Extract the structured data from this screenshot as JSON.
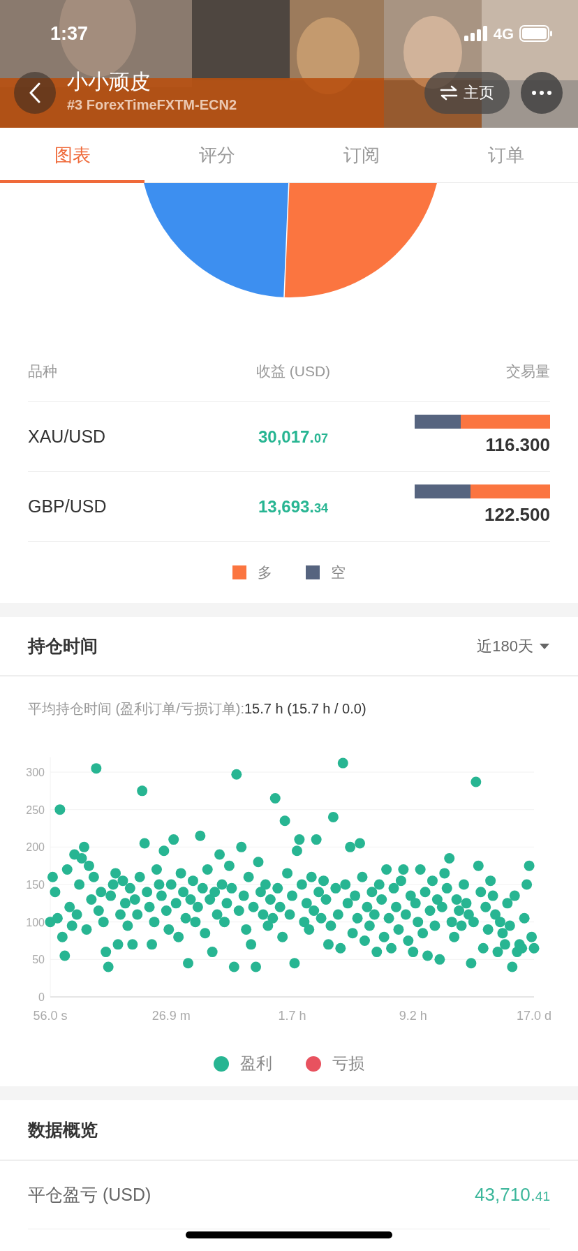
{
  "status_bar": {
    "time": "1:37",
    "network": "4G"
  },
  "header": {
    "title": "小小顽皮",
    "subtitle": "#3 ForexTimeFXTM-ECN2",
    "home_button": "主页"
  },
  "tabs": [
    {
      "label": "图表",
      "selected": true
    },
    {
      "label": "评分",
      "selected": false
    },
    {
      "label": "订阅",
      "selected": false
    },
    {
      "label": "订单",
      "selected": false
    }
  ],
  "symbols_table": {
    "columns": [
      "品种",
      "收益 (USD)",
      "交易量"
    ],
    "rows": [
      {
        "symbol": "XAU/USD",
        "profit_main": "30,017.",
        "profit_decimals": "07",
        "volume": "116.300",
        "long_part": {
          "level": 0.66
        }
      },
      {
        "symbol": "GBP/USD",
        "profit_main": "13,693.",
        "profit_decimals": "34",
        "volume": "122.500",
        "long_part": {
          "level": 0.59
        }
      }
    ],
    "legend": [
      {
        "label": "多",
        "color": "#fb7540"
      },
      {
        "label": "空",
        "color": "#56647f"
      }
    ]
  },
  "holding_time": {
    "title": "持仓时间",
    "period": "近180天",
    "summary_label": "平均持仓时间 (盈利订单/亏损订单):",
    "summary_value": "15.7 h (15.7 h / 0.0)",
    "chart_data": {
      "type": "scatter",
      "grid": true,
      "ylim": [
        0,
        320
      ],
      "yticks": [
        0,
        50,
        100,
        150,
        200,
        250,
        300
      ],
      "categories": [
        "56.0 s",
        null,
        null,
        null,
        null,
        null,
        null,
        null,
        null,
        null,
        null,
        null,
        null,
        null,
        null,
        null,
        null,
        null,
        null,
        null,
        null,
        null,
        null,
        null,
        null,
        null,
        null,
        null,
        null,
        null,
        null,
        null,
        null,
        null,
        null,
        null,
        null,
        null,
        null,
        null,
        null,
        null,
        null,
        null,
        null,
        null,
        null,
        null,
        null,
        null,
        "26.9 m",
        null,
        null,
        null,
        null,
        null,
        null,
        null,
        null,
        null,
        null,
        null,
        null,
        null,
        null,
        null,
        null,
        null,
        null,
        null,
        null,
        null,
        null,
        null,
        null,
        null,
        null,
        null,
        null,
        null,
        null,
        null,
        null,
        null,
        null,
        null,
        null,
        null,
        null,
        null,
        null,
        null,
        null,
        null,
        null,
        null,
        null,
        null,
        null,
        null,
        "1.7 h",
        null,
        null,
        null,
        null,
        null,
        null,
        null,
        null,
        null,
        null,
        null,
        null,
        null,
        null,
        null,
        null,
        null,
        null,
        null,
        null,
        null,
        null,
        null,
        null,
        null,
        null,
        null,
        null,
        null,
        null,
        null,
        null,
        null,
        null,
        null,
        null,
        null,
        null,
        null,
        null,
        null,
        null,
        null,
        null,
        null,
        null,
        null,
        null,
        null,
        "9.2 h",
        null,
        null,
        null,
        null,
        null,
        null,
        null,
        null,
        null,
        null,
        null,
        null,
        null,
        null,
        null,
        null,
        null,
        null,
        null,
        null,
        null,
        null,
        null,
        null,
        null,
        null,
        null,
        null,
        null,
        null,
        null,
        null,
        null,
        null,
        null,
        null,
        null,
        null,
        null,
        null,
        null,
        null,
        null,
        null,
        null,
        null,
        null,
        null,
        null,
        "17.0 d"
      ],
      "series": [
        {
          "name": "盈利",
          "color": "#27b592",
          "values": [
            100,
            160,
            140,
            105,
            250,
            80,
            55,
            170,
            120,
            95,
            190,
            110,
            150,
            185,
            200,
            90,
            175,
            130,
            160,
            305,
            115,
            140,
            100,
            60,
            40,
            135,
            150,
            165,
            70,
            110,
            155,
            125,
            95,
            145,
            70,
            130,
            110,
            160,
            275,
            205,
            140,
            120,
            70,
            100,
            170,
            150,
            135,
            195,
            115,
            90,
            150,
            210,
            125,
            80,
            165,
            140,
            105,
            45,
            130,
            155,
            100,
            120,
            215,
            145,
            85,
            170,
            130,
            60,
            140,
            110,
            190,
            150,
            100,
            125,
            175,
            145,
            40,
            297,
            115,
            200,
            135,
            90,
            160,
            70,
            120,
            40,
            180,
            140,
            110,
            150,
            95,
            130,
            105,
            265,
            145,
            120,
            80,
            235,
            165,
            110,
            135,
            45,
            195,
            210,
            150,
            100,
            125,
            90,
            160,
            115,
            210,
            140,
            105,
            155,
            130,
            70,
            95,
            240,
            145,
            110,
            65,
            312,
            150,
            125,
            200,
            85,
            135,
            105,
            205,
            160,
            75,
            120,
            95,
            140,
            110,
            60,
            150,
            130,
            80,
            170,
            105,
            65,
            145,
            120,
            90,
            155,
            170,
            110,
            75,
            135,
            60,
            125,
            100,
            170,
            85,
            140,
            55,
            115,
            155,
            95,
            130,
            50,
            120,
            165,
            145,
            185,
            100,
            80,
            130,
            115,
            95,
            150,
            125,
            110,
            45,
            100,
            287,
            175,
            140,
            65,
            120,
            90,
            155,
            135,
            110,
            60,
            100,
            85,
            70,
            125,
            95,
            40,
            135,
            60,
            70,
            65,
            105,
            150,
            175,
            80,
            65
          ]
        }
      ]
    },
    "legend": [
      {
        "label": "亏损",
        "color": "#e8525f"
      }
    ]
  },
  "overview": {
    "title": "数据概览",
    "rows": [
      {
        "label": "平仓盈亏 (USD)",
        "value_main": "43,710.",
        "value_decimals": "41"
      }
    ]
  }
}
